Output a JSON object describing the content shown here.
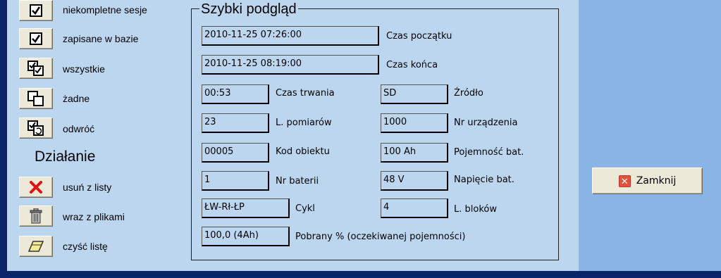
{
  "sidebar": {
    "buttons": [
      {
        "label": "niekompletne sesje",
        "icon": "checkbox-checked-icon"
      },
      {
        "label": "zapisane w bazie",
        "icon": "checkbox-checked-icon"
      },
      {
        "label": "wszystkie",
        "icon": "select-all-icon"
      },
      {
        "label": "żadne",
        "icon": "select-none-icon"
      },
      {
        "label": "odwróć",
        "icon": "invert-selection-icon"
      }
    ],
    "action_heading": "Działanie",
    "actions": [
      {
        "label": "usuń z listy",
        "icon": "delete-x-icon"
      },
      {
        "label": "wraz z plikami",
        "icon": "trash-icon"
      },
      {
        "label": "czyść listę",
        "icon": "eraser-icon"
      }
    ]
  },
  "preview": {
    "title": "Szybki podgląd",
    "start_time": {
      "value": "2010-11-25 07:26:00",
      "label": "Czas początku"
    },
    "end_time": {
      "value": "2010-11-25 08:19:00",
      "label": "Czas końca"
    },
    "duration": {
      "value": "00:53",
      "label": "Czas trwania"
    },
    "source": {
      "value": "SD",
      "label": "Źródło"
    },
    "measurements": {
      "value": "23",
      "label": "L. pomiarów"
    },
    "device_no": {
      "value": "1000",
      "label": "Nr urządzenia"
    },
    "object_code": {
      "value": "00005",
      "label": "Kod obiektu"
    },
    "battery_capacity": {
      "value": "100 Ah",
      "label": "Pojemność bat."
    },
    "battery_no": {
      "value": "1",
      "label": "Nr baterii"
    },
    "battery_voltage": {
      "value": "48 V",
      "label": "Napięcie bat."
    },
    "cycle": {
      "value": "ŁW-Rł-ŁP",
      "label": "Cykl"
    },
    "blocks": {
      "value": "4",
      "label": "L. bloków"
    },
    "drawn_percent": {
      "value": "100,0 (4Ah)",
      "label": "Pobrany % (oczekiwanej pojemności)"
    }
  },
  "close_button": {
    "label": "Zamknij",
    "icon": "close-icon"
  },
  "colors": {
    "panel": "#bdd6f0",
    "right_bar": "#88b4e6",
    "frame_border": "#0a246a"
  }
}
